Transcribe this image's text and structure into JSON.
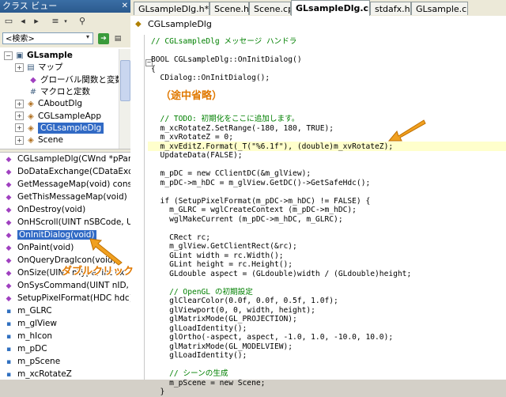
{
  "class_view": {
    "title": "クラス ビュー",
    "close_glyph": "✕",
    "search_placeholder": "<検索>",
    "tree": [
      {
        "label": "GLsample",
        "icon": "project-icon",
        "expander": "−",
        "bold": true
      },
      {
        "label": "マップ",
        "icon": "map-icon",
        "expander": "+"
      },
      {
        "label": "グローバル関数と変数",
        "icon": "global-icon",
        "expander": ""
      },
      {
        "label": "マクロと定数",
        "icon": "macro-icon",
        "expander": ""
      },
      {
        "label": "CAboutDlg",
        "icon": "class-icon",
        "expander": "+"
      },
      {
        "label": "CGLsampleApp",
        "icon": "class-icon",
        "expander": "+"
      },
      {
        "label": "CGLsampleDlg",
        "icon": "class-icon",
        "expander": "+",
        "selected": true
      },
      {
        "label": "Scene",
        "icon": "class-icon",
        "expander": "+"
      }
    ],
    "members": [
      {
        "label": "CGLsampleDlg(CWnd *pPar",
        "icon": "method-icon"
      },
      {
        "label": "DoDataExchange(CDataExc",
        "icon": "method-icon"
      },
      {
        "label": "GetMessageMap(void) const",
        "icon": "method-icon"
      },
      {
        "label": "GetThisMessageMap(void)",
        "icon": "method-icon"
      },
      {
        "label": "OnDestroy(void)",
        "icon": "method-icon"
      },
      {
        "label": "OnHScroll(UINT nSBCode, U",
        "icon": "method-icon"
      },
      {
        "label": "OnInitDialog(void)",
        "icon": "method-icon",
        "selected": true
      },
      {
        "label": "OnPaint(void)",
        "icon": "method-icon"
      },
      {
        "label": "OnQueryDragIcon(void)",
        "icon": "method-icon"
      },
      {
        "label": "OnSize(UINT nType, int cx,",
        "icon": "method-icon"
      },
      {
        "label": "OnSysCommand(UINT nID,",
        "icon": "method-icon"
      },
      {
        "label": "SetupPixelFormat(HDC hdc)",
        "icon": "method-icon"
      },
      {
        "label": "m_GLRC",
        "icon": "field-icon"
      },
      {
        "label": "m_glView",
        "icon": "field-icon"
      },
      {
        "label": "m_hIcon",
        "icon": "field-icon"
      },
      {
        "label": "m_pDC",
        "icon": "field-icon"
      },
      {
        "label": "m_pScene",
        "icon": "field-icon"
      },
      {
        "label": "m_xcRotateZ",
        "icon": "field-icon"
      }
    ]
  },
  "tabs": [
    {
      "label": "GLsampleDlg.h*",
      "active": false
    },
    {
      "label": "Scene.h",
      "active": false
    },
    {
      "label": "Scene.cpp",
      "active": false
    },
    {
      "label": "GLsampleDlg.cpp*",
      "active": true
    },
    {
      "label": "stdafx.h",
      "active": false
    },
    {
      "label": "GLsample.cpp",
      "active": false
    }
  ],
  "function_bar": {
    "label": "CGLsampleDlg"
  },
  "code_lines": [
    {
      "text": "// CGLsampleDlg メッセージ ハンドラ",
      "type": "comment"
    },
    {
      "text": "",
      "type": "plain"
    },
    {
      "text": "BOOL CGLsampleDlg::OnInitDialog()",
      "type": "plain"
    },
    {
      "text": "{",
      "type": "plain"
    },
    {
      "text": "  CDialog::OnInitDialog();",
      "type": "plain"
    },
    {
      "text": "",
      "type": "plain"
    },
    {
      "text": "",
      "type": "plain"
    },
    {
      "text": "",
      "type": "plain"
    },
    {
      "text": "  // TODO: 初期化をここに追加します。",
      "type": "comment"
    },
    {
      "text": "  m_xcRotateZ.SetRange(-180, 180, TRUE);",
      "type": "plain"
    },
    {
      "text": "  m_xvRotateZ = 0;",
      "type": "plain"
    },
    {
      "text": "  m_xvEditZ.Format(_T(\"%6.1f\"), (double)m_xvRotateZ);",
      "type": "highlight"
    },
    {
      "text": "  UpdateData(FALSE);",
      "type": "plain"
    },
    {
      "text": "",
      "type": "plain"
    },
    {
      "text": "  m_pDC = new CClientDC(&m_glView);",
      "type": "plain"
    },
    {
      "text": "  m_pDC->m_hDC = m_glView.GetDC()->GetSafeHdc();",
      "type": "plain"
    },
    {
      "text": "",
      "type": "plain"
    },
    {
      "text": "  if (SetupPixelFormat(m_pDC->m_hDC) != FALSE) {",
      "type": "plain"
    },
    {
      "text": "    m_GLRC = wglCreateContext (m_pDC->m_hDC);",
      "type": "plain"
    },
    {
      "text": "    wglMakeCurrent (m_pDC->m_hDC, m_GLRC);",
      "type": "plain"
    },
    {
      "text": "",
      "type": "plain"
    },
    {
      "text": "    CRect rc;",
      "type": "plain"
    },
    {
      "text": "    m_glView.GetClientRect(&rc);",
      "type": "plain"
    },
    {
      "text": "    GLint width = rc.Width();",
      "type": "plain"
    },
    {
      "text": "    GLint height = rc.Height();",
      "type": "plain"
    },
    {
      "text": "    GLdouble aspect = (GLdouble)width / (GLdouble)height;",
      "type": "plain"
    },
    {
      "text": "",
      "type": "plain"
    },
    {
      "text": "    // OpenGL の初期設定",
      "type": "comment"
    },
    {
      "text": "    glClearColor(0.0f, 0.0f, 0.5f, 1.0f);",
      "type": "plain"
    },
    {
      "text": "    glViewport(0, 0, width, height);",
      "type": "plain"
    },
    {
      "text": "    glMatrixMode(GL_PROJECTION);",
      "type": "plain"
    },
    {
      "text": "    glLoadIdentity();",
      "type": "plain"
    },
    {
      "text": "    glOrtho(-aspect, aspect, -1.0, 1.0, -10.0, 10.0);",
      "type": "plain"
    },
    {
      "text": "    glMatrixMode(GL_MODELVIEW);",
      "type": "plain"
    },
    {
      "text": "    glLoadIdentity();",
      "type": "plain"
    },
    {
      "text": "",
      "type": "plain"
    },
    {
      "text": "    // シーンの生成",
      "type": "comment"
    },
    {
      "text": "    m_pScene = new Scene;",
      "type": "plain"
    },
    {
      "text": "  }",
      "type": "plain"
    }
  ],
  "annotations": {
    "omitted": "（途中省略）",
    "double_click": "ダブルクリック"
  },
  "colors": {
    "annotation": "#e07800",
    "selection": "#316ac5",
    "highlight_line": "#ffffcc",
    "comment": "#008000",
    "keyword": "#0000ff"
  }
}
